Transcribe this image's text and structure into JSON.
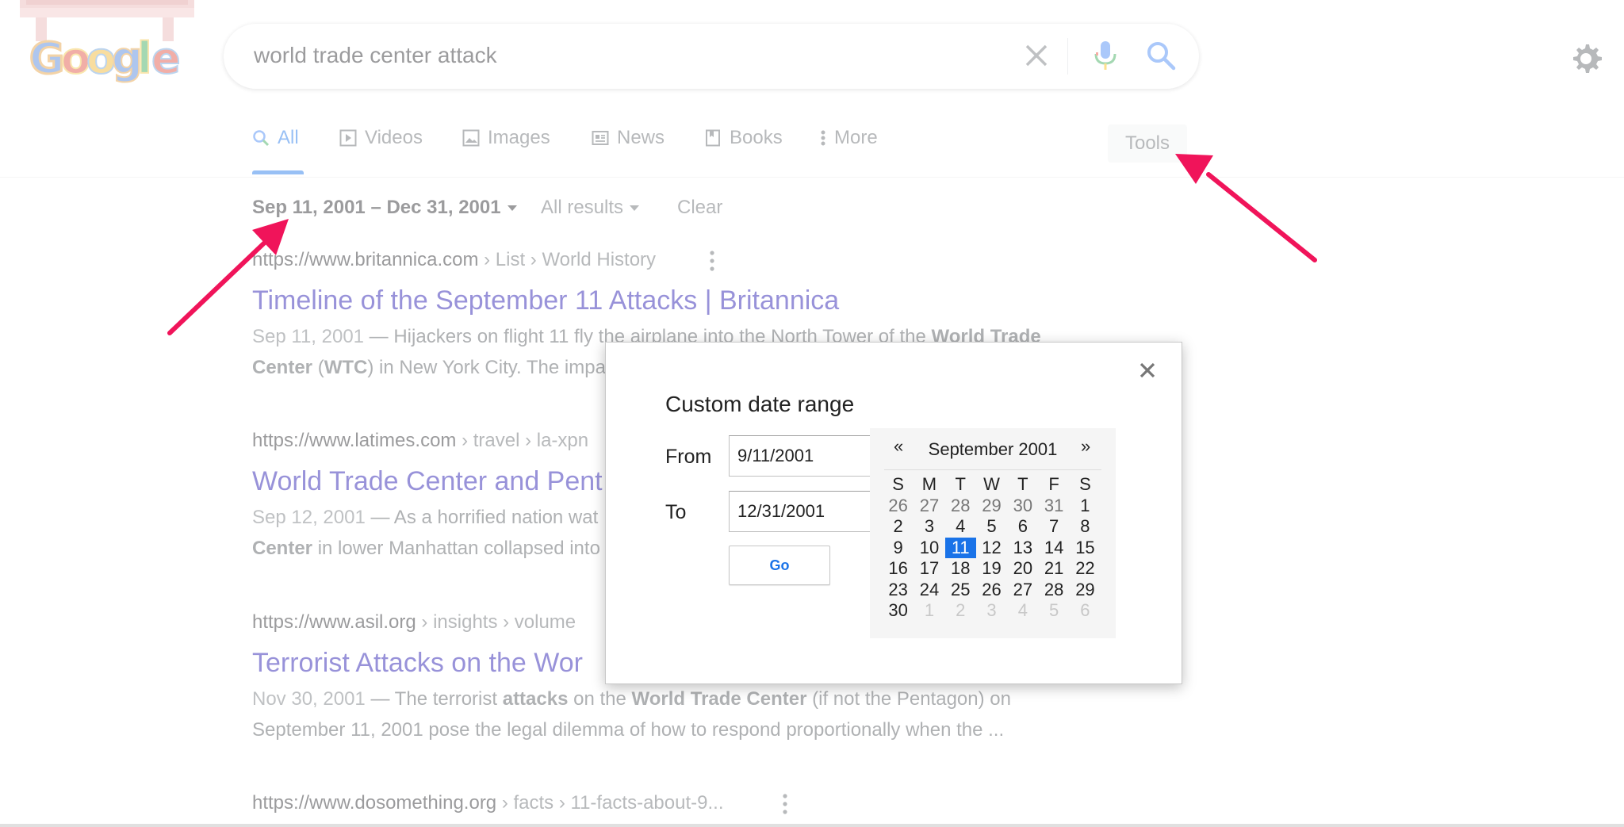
{
  "header": {
    "logo_text": "Google",
    "search_query": "world trade center attack"
  },
  "tabs": [
    {
      "label": "All",
      "icon": "search-icon",
      "active": true
    },
    {
      "label": "Videos",
      "icon": "video-icon"
    },
    {
      "label": "Images",
      "icon": "image-icon"
    },
    {
      "label": "News",
      "icon": "news-icon"
    },
    {
      "label": "Books",
      "icon": "book-icon"
    },
    {
      "label": "More",
      "icon": "more-vert-icon"
    }
  ],
  "tools_label": "Tools",
  "filters": {
    "date_range": "Sep 11, 2001 – Dec 31, 2001",
    "results": "All results",
    "clear": "Clear"
  },
  "results": [
    {
      "site": "https://www.britannica.com",
      "path": " › List › World History",
      "title": "Timeline of the September 11 Attacks | Britannica",
      "date": "Sep 11, 2001",
      "snippet_line1": " — Hijackers on flight 11 fly the airplane into the North Tower of the ",
      "snippet_bold1": "World Trade",
      "snippet_bold2": "Center",
      "snippet_mid": " (",
      "snippet_bold3": "WTC",
      "snippet_line2": ") in New York City. The impa"
    },
    {
      "site": "https://www.latimes.com",
      "path": " › travel › la-xpn",
      "title": "World Trade Center and Pent",
      "date": "Sep 12, 2001",
      "snippet_line1": " — As a horrified nation wat",
      "snippet_bold1": "Center",
      "snippet_line2": " in lower Manhattan collapsed into"
    },
    {
      "site": "https://www.asil.org",
      "path": " › insights › volume",
      "title": "Terrorist Attacks on the Wor",
      "date": "Nov 30, 2001",
      "snippet_line1a": " — The terrorist ",
      "snippet_bold1": "attacks",
      "snippet_line1b": " on the ",
      "snippet_bold2": "World Trade Center",
      "snippet_line1c": " (if not the Pentagon) on",
      "snippet_line2": "September 11, 2001 pose the legal dilemma of how to respond proportionally when the ..."
    },
    {
      "site": "https://www.dosomething.org",
      "path": " › facts › 11-facts-about-9..."
    }
  ],
  "dialog": {
    "title": "Custom date range",
    "from_label": "From",
    "from_value": "9/11/2001",
    "to_label": "To",
    "to_value": "12/31/2001",
    "go_label": "Go",
    "close_icon": "close-icon",
    "calendar": {
      "prev": "«",
      "next": "»",
      "month": "September 2001",
      "weekdays": [
        "S",
        "M",
        "T",
        "W",
        "T",
        "F",
        "S"
      ],
      "days": [
        {
          "d": "26",
          "t": "prev"
        },
        {
          "d": "27",
          "t": "prev"
        },
        {
          "d": "28",
          "t": "prev"
        },
        {
          "d": "29",
          "t": "prev"
        },
        {
          "d": "30",
          "t": "prev"
        },
        {
          "d": "31",
          "t": "prev"
        },
        {
          "d": "1",
          "t": "cur"
        },
        {
          "d": "2",
          "t": "cur"
        },
        {
          "d": "3",
          "t": "cur"
        },
        {
          "d": "4",
          "t": "cur"
        },
        {
          "d": "5",
          "t": "cur"
        },
        {
          "d": "6",
          "t": "cur"
        },
        {
          "d": "7",
          "t": "cur"
        },
        {
          "d": "8",
          "t": "cur"
        },
        {
          "d": "9",
          "t": "cur"
        },
        {
          "d": "10",
          "t": "cur"
        },
        {
          "d": "11",
          "t": "sel"
        },
        {
          "d": "12",
          "t": "cur"
        },
        {
          "d": "13",
          "t": "cur"
        },
        {
          "d": "14",
          "t": "cur"
        },
        {
          "d": "15",
          "t": "cur"
        },
        {
          "d": "16",
          "t": "cur"
        },
        {
          "d": "17",
          "t": "cur"
        },
        {
          "d": "18",
          "t": "cur"
        },
        {
          "d": "19",
          "t": "cur"
        },
        {
          "d": "20",
          "t": "cur"
        },
        {
          "d": "21",
          "t": "cur"
        },
        {
          "d": "22",
          "t": "cur"
        },
        {
          "d": "23",
          "t": "cur"
        },
        {
          "d": "24",
          "t": "cur"
        },
        {
          "d": "25",
          "t": "cur"
        },
        {
          "d": "26",
          "t": "cur"
        },
        {
          "d": "27",
          "t": "cur"
        },
        {
          "d": "28",
          "t": "cur"
        },
        {
          "d": "29",
          "t": "cur"
        },
        {
          "d": "30",
          "t": "cur"
        },
        {
          "d": "1",
          "t": "next"
        },
        {
          "d": "2",
          "t": "next"
        },
        {
          "d": "3",
          "t": "next"
        },
        {
          "d": "4",
          "t": "next"
        },
        {
          "d": "5",
          "t": "next"
        },
        {
          "d": "6",
          "t": "next"
        }
      ]
    }
  },
  "colors": {
    "accent": "#1a73e8",
    "link": "#1a0dab",
    "annotation_arrow": "#f0145a"
  }
}
